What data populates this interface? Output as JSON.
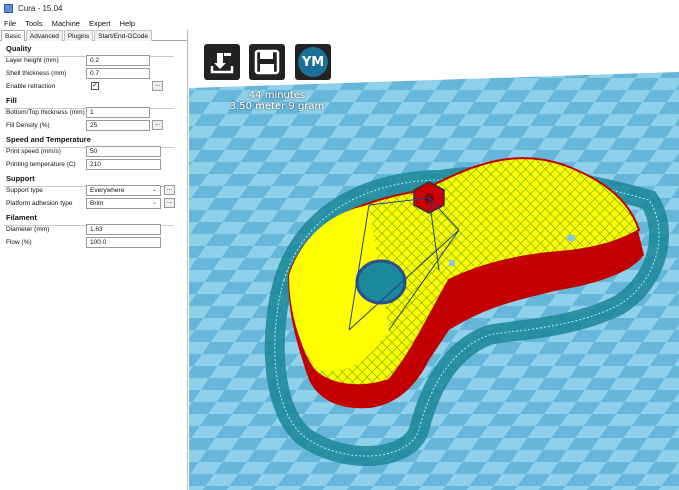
{
  "window": {
    "title": "Cura - 15.04"
  },
  "menu": [
    "File",
    "Tools",
    "Machine",
    "Expert",
    "Help"
  ],
  "tabs": [
    "Basic",
    "Advanced",
    "Plugins",
    "Start/End-GCode"
  ],
  "sections": {
    "quality": {
      "title": "Quality",
      "layer_height_label": "Layer height (mm)",
      "layer_height": "0.2",
      "shell_thickness_label": "Shell thickness (mm)",
      "shell_thickness": "0.7",
      "retraction_label": "Enable retraction",
      "retraction_checked": "✓"
    },
    "fill": {
      "title": "Fill",
      "bottom_top_label": "Bottom/Top thickness (mm)",
      "bottom_top": "1",
      "density_label": "Fill Density (%)",
      "density": "25"
    },
    "speed": {
      "title": "Speed and Temperature",
      "print_speed_label": "Print speed (mm/s)",
      "print_speed": "50",
      "print_temp_label": "Printing temperature (C)",
      "print_temp": "210"
    },
    "support": {
      "title": "Support",
      "support_type_label": "Support type",
      "support_type": "Everywhere",
      "adhesion_label": "Platform adhesion type",
      "adhesion": "Brim"
    },
    "filament": {
      "title": "Filament",
      "diameter_label": "Diameter (mm)",
      "diameter": "1.63",
      "flow_label": "Flow (%)",
      "flow": "100.0"
    }
  },
  "viewport": {
    "print_time": "44 minutes",
    "print_material": "3.50 meter 9 gram",
    "view_mode_badge": "YM",
    "icons": [
      "load-model-icon",
      "save-toolpath-icon",
      "view-mode-icon"
    ],
    "colors": {
      "bed_light": "#8ecfe8",
      "bed_dark": "#5aa9cf",
      "brim": "#1a8a9a",
      "infill": "#ffff00",
      "outer_wall": "#cc0000"
    }
  }
}
